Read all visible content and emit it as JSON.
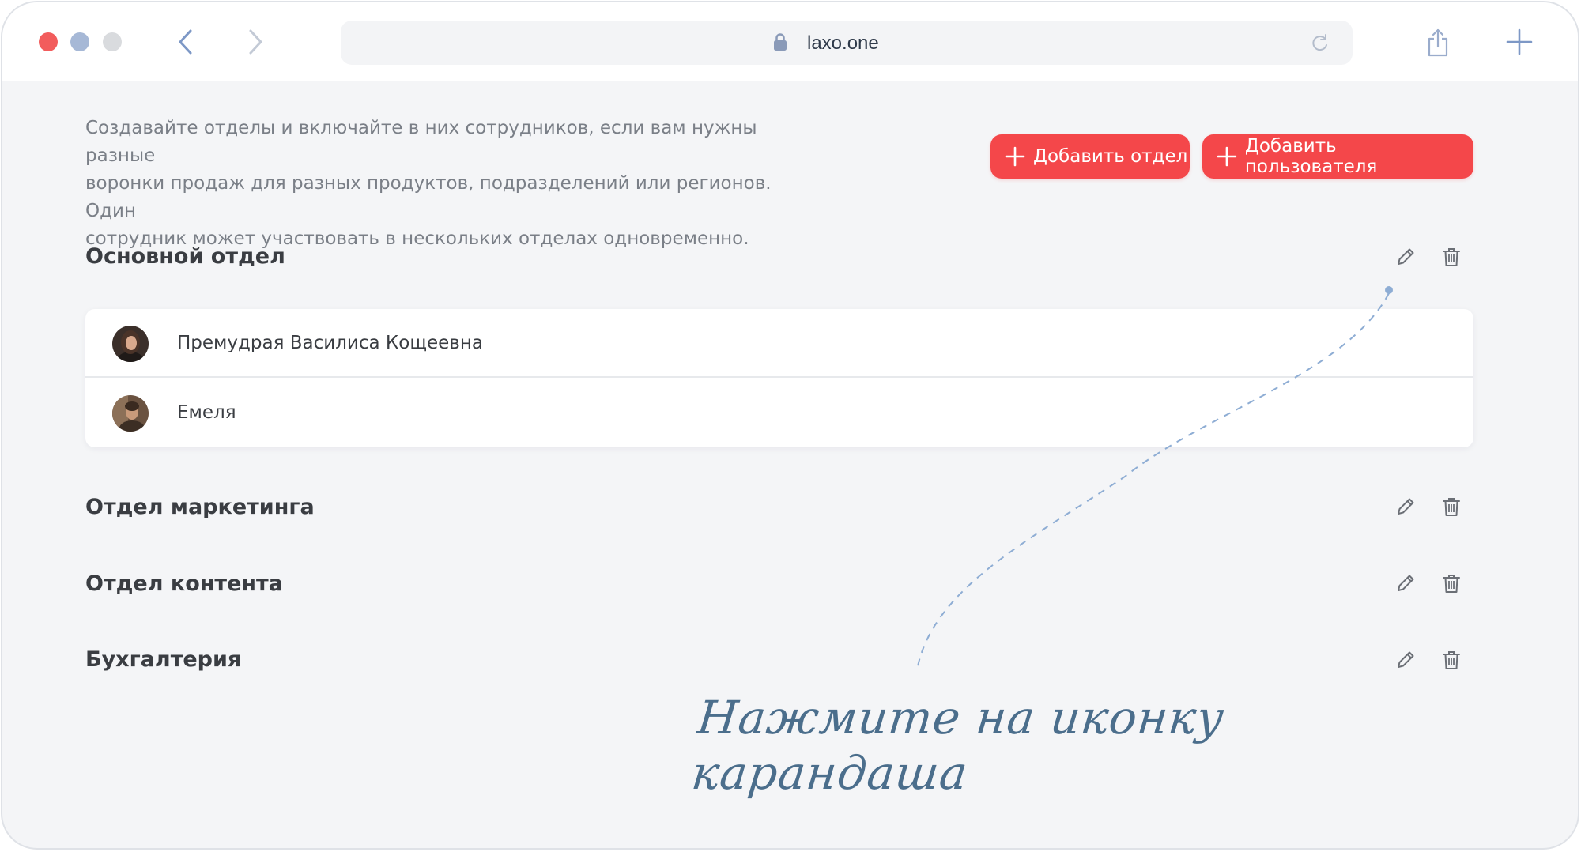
{
  "browser": {
    "url": "laxo.one",
    "traffic_colors": {
      "close": "#f25c5c",
      "minimize": "#a6b8d6",
      "zoom": "#d9dbde"
    }
  },
  "page": {
    "intro_lines": [
      "Создавайте отделы и включайте в них сотрудников, если вам нужны разные",
      "воронки продаж для разных продуктов, подразделений или регионов. Один",
      "сотрудник может участвовать в нескольких отделах одновременно."
    ],
    "add_department_label": "Добавить отдел",
    "add_user_label": "Добавить пользователя",
    "accent_color": "#f4474a"
  },
  "departments": [
    {
      "name": "Основной отдел",
      "members": [
        {
          "name": "Премудрая Василиса Кощеевна"
        },
        {
          "name": "Емеля"
        }
      ]
    },
    {
      "name": "Отдел маркетинга"
    },
    {
      "name": "Отдел контента"
    },
    {
      "name": "Бухгалтерия"
    }
  ],
  "annotation": {
    "lines": [
      "Нажмите на иконку",
      "карандаша"
    ]
  }
}
